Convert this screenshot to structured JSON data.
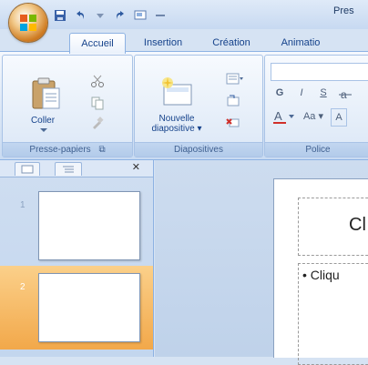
{
  "window": {
    "title": "Pres"
  },
  "tabs": [
    {
      "label": "Accueil"
    },
    {
      "label": "Insertion"
    },
    {
      "label": "Création"
    },
    {
      "label": "Animatio"
    }
  ],
  "ribbon": {
    "clipboard": {
      "paste_label": "Coller",
      "group_label": "Presse-papiers"
    },
    "slides": {
      "new_slide_label": "Nouvelle diapositive",
      "new_slide_line1": "Nouvelle",
      "new_slide_line2": "diapositive",
      "group_label": "Diapositives"
    },
    "font": {
      "bold": "G",
      "italic": "I",
      "underline": "S",
      "text_size": "Aa",
      "group_label": "Police"
    }
  },
  "slides_pane": {
    "slides": [
      {
        "number": "1"
      },
      {
        "number": "2"
      }
    ],
    "selected": "2"
  },
  "editor": {
    "title_placeholder": "Cl",
    "body_placeholder": "• Cliqu"
  },
  "colors": {
    "accent": "#f2a84a",
    "ribbon_text": "#15428b"
  }
}
